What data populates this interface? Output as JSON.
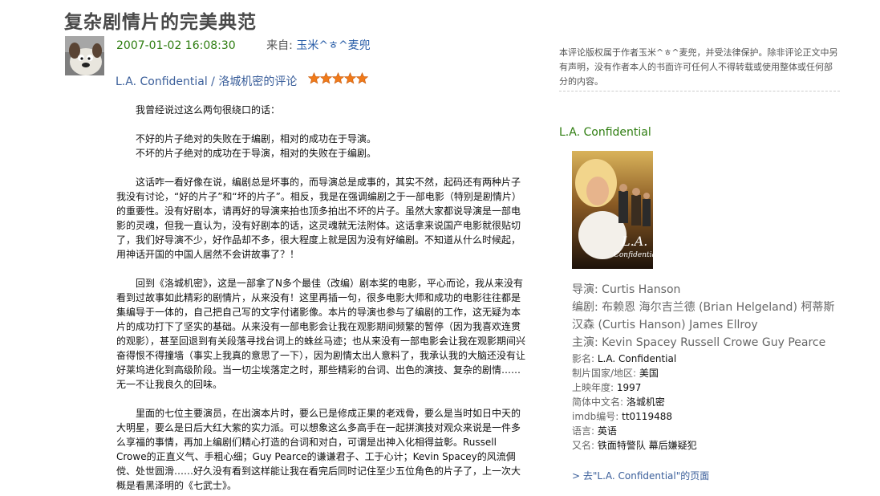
{
  "page": {
    "title": "复杂剧情片的完美典范"
  },
  "meta": {
    "date": "2007-01-02 16:08:30",
    "from_label": "来自:",
    "author": "玉米^ㅎ^麦兜"
  },
  "review": {
    "of_label": "L.A. Confidential / 洛城机密的评论",
    "rating_stars": 5,
    "paragraphs": [
      "我曾经说过这么两句很绕口的话：",
      "不好的片子绝对的失败在于编剧，相对的成功在于导演。",
      "不坏的片子绝对的成功在于导演，相对的失败在于编剧。",
      "这话咋一看好像在说，编剧总是坏事的，而导演总是成事的，其实不然，起码还有两种片子我没有讨论，“好的片子”和“坏的片子”。相反，我是在强调编剧之于一部电影（特别是剧情片）的重要性。没有好剧本，请再好的导演来拍也顶多拍出不坏的片子。虽然大家都说导演是一部电影的灵魂，但我一直认为，没有好剧本的话，这灵魂就无法附体。这话拿来说国产电影就很贴切了，我们好导演不少，好作品却不多，很大程度上就是因为没有好编剧。不知道从什么时候起，用神话开国的中国人居然不会讲故事了？！",
      "回到《洛城机密》，这是一部拿了N多个最佳（改编）剧本奖的电影，平心而论，我从来没有看到过故事如此精彩的剧情片，从来没有！这里再插一句，很多电影大师和成功的电影往往都是集编导于一体的，自己把自己写的文字付诸影像。本片的导演也参与了编剧的工作，这无疑为本片的成功打下了坚实的基础。从来没有一部电影会让我在观影期间频繁的暂停（因为我喜欢连贯的观影），甚至回退到有关段落寻找台词上的蛛丝马迹；也从来没有一部电影会让我在观影期间兴奋得恨不得撞墙（事实上我真的意思了一下），因为剧情太出人意料了，我承认我的大脑还没有让好莱坞进化到高级阶段。当一切尘埃落定之时，那些精彩的台词、出色的演技、复杂的剧情……无一不让我良久的回味。",
      "里面的七位主要演员，在出演本片时，要么已是修成正果的老戏骨，要么是当时如日中天的大明星，要么是日后大红大紫的实力派。可以想象这么多高手在一起拼演技对观众来说是一件多么享福的事情，再加上编剧们精心打造的台词和对白，可谓是出神入化相得益彰。Russell Crowe的正直义气、手粗心细；Guy Pearce的谦谦君子、工于心计；Kevin Spacey的风流倜傥、处世圆滑……好久没有看到这样能让我在看完后同时记住至少五位角色的片子了，上一次大概是看黑泽明的《七武士》。"
    ]
  },
  "sidebar": {
    "copyright": "本评论版权属于作者玉米^ㅎ^麦兜，并受法律保护。除非评论正文中另有声明，没有作者本人的书面许可任何人不得转载或使用整体或任何部分的内容。",
    "movie_title": "L.A. Confidential",
    "director": "导演: Curtis Hanson",
    "writers": "编剧: 布赖恩 海尔吉兰德 (Brian Helgeland) 柯蒂斯 汉森 (Curtis Hanson) James Ellroy",
    "cast": "主演: Kevin Spacey Russell Crowe Guy Pearce",
    "details": [
      {
        "label": "影名: ",
        "value": "L.A. Confidential"
      },
      {
        "label": "制片国家/地区: ",
        "value": "美国"
      },
      {
        "label": "上映年度: ",
        "value": "1997"
      },
      {
        "label": "简体中文名: ",
        "value": "洛城机密"
      },
      {
        "label": "imdb编号: ",
        "value": "tt0119488"
      },
      {
        "label": "语言: ",
        "value": "英语"
      },
      {
        "label": "又名: ",
        "value": "铁面特警队 幕后嫌疑犯"
      }
    ],
    "go_link": "> 去\"L.A. Confidential\"的页面"
  },
  "colors": {
    "title": "#494949",
    "date_green": "#2e7d10",
    "link_blue": "#3a5e9a",
    "star_orange": "#f07a1a"
  },
  "icons": {
    "star": "star-icon",
    "avatar": "user-avatar-wallace-gromit"
  }
}
